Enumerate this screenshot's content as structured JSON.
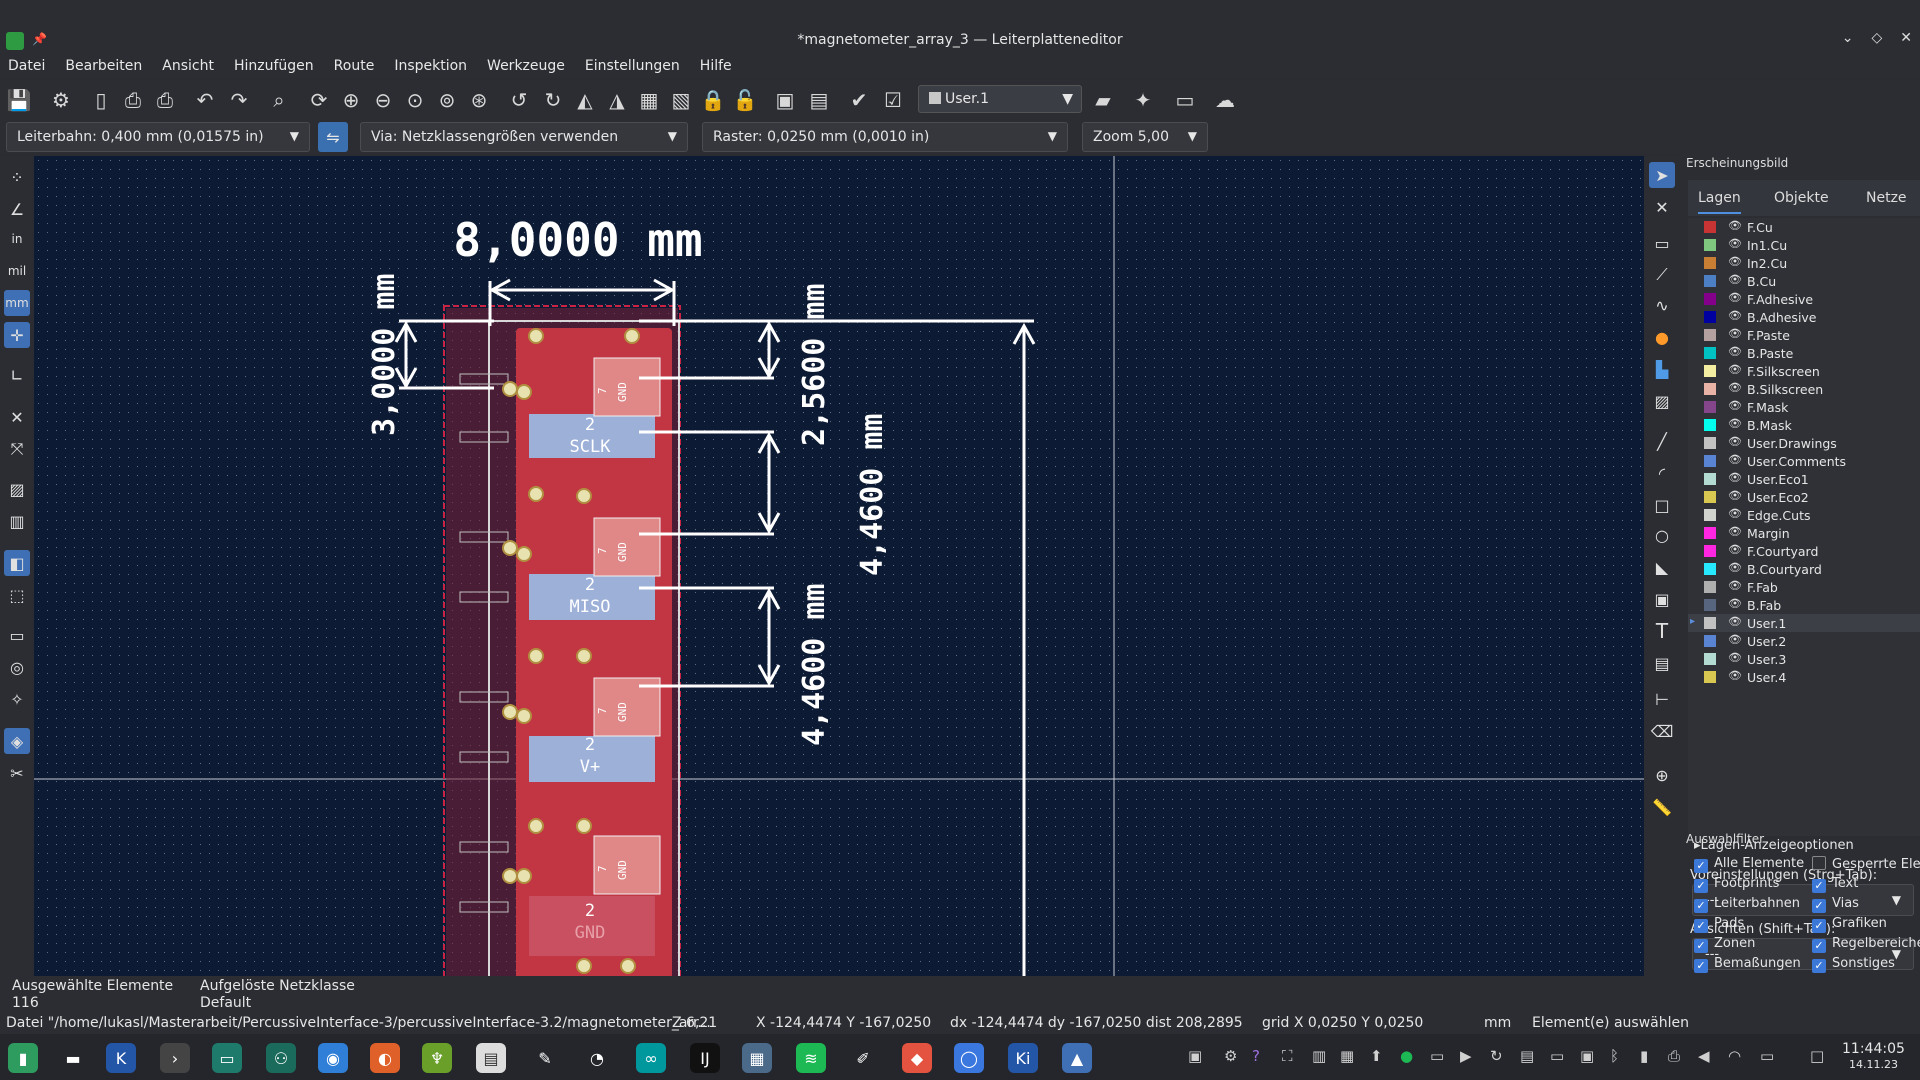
{
  "window": {
    "title": "*magnetometer_array_3 — Leiterplatteneditor"
  },
  "menu": [
    "Datei",
    "Bearbeiten",
    "Ansicht",
    "Hinzufügen",
    "Route",
    "Inspektion",
    "Werkzeuge",
    "Einstellungen",
    "Hilfe"
  ],
  "toolbar": {
    "layer_select": "User.1"
  },
  "toolbar2": {
    "track_width": "Leiterbahn: 0,400 mm (0,01575 in)",
    "via_size": "Via: Netzklassengrößen verwenden",
    "grid": "Raster: 0,0250 mm (0,0010 in)",
    "zoom": "Zoom 5,00"
  },
  "left_toolbar": {
    "units_in": "in",
    "units_mil": "mil",
    "units_mm": "mm"
  },
  "canvas": {
    "dim_width": "8,0000 mm",
    "dim_left": "3,0000 mm",
    "dim_a": "2,5600 mm",
    "dim_b": "4,4600 mm",
    "dim_c": "4,4600 mm",
    "pad_labels": [
      "SCLK",
      "MISO",
      "V+",
      "GND"
    ],
    "pad_numbers": [
      "2",
      "2",
      "2",
      "2"
    ],
    "gnd_text": "GND",
    "seven": "7"
  },
  "panel": {
    "title": "Erscheinungsbild",
    "tabs": [
      "Lagen",
      "Objekte",
      "Netze"
    ],
    "layers": [
      {
        "name": "F.Cu",
        "color": "#c83434"
      },
      {
        "name": "In1.Cu",
        "color": "#7fc87f"
      },
      {
        "name": "In2.Cu",
        "color": "#c87f34"
      },
      {
        "name": "B.Cu",
        "color": "#4d7fc4"
      },
      {
        "name": "F.Adhesive",
        "color": "#84008a"
      },
      {
        "name": "B.Adhesive",
        "color": "#0000a0"
      },
      {
        "name": "F.Paste",
        "color": "#b4a09e"
      },
      {
        "name": "B.Paste",
        "color": "#00c2c2"
      },
      {
        "name": "F.Silkscreen",
        "color": "#f2eda1"
      },
      {
        "name": "B.Silkscreen",
        "color": "#e8b2a7"
      },
      {
        "name": "F.Mask",
        "color": "#84458a"
      },
      {
        "name": "B.Mask",
        "color": "#02ffee"
      },
      {
        "name": "User.Drawings",
        "color": "#c2c2c2"
      },
      {
        "name": "User.Comments",
        "color": "#5984d4"
      },
      {
        "name": "User.Eco1",
        "color": "#b4dbd2"
      },
      {
        "name": "User.Eco2",
        "color": "#d8c852"
      },
      {
        "name": "Edge.Cuts",
        "color": "#d0d2cd"
      },
      {
        "name": "Margin",
        "color": "#ff26e2"
      },
      {
        "name": "F.Courtyard",
        "color": "#ff26e2"
      },
      {
        "name": "B.Courtyard",
        "color": "#26e9ff"
      },
      {
        "name": "F.Fab",
        "color": "#afafaf"
      },
      {
        "name": "B.Fab",
        "color": "#58657f"
      },
      {
        "name": "User.1",
        "color": "#c2c2c2"
      },
      {
        "name": "User.2",
        "color": "#5984d4"
      },
      {
        "name": "User.3",
        "color": "#b4dbd2"
      },
      {
        "name": "User.4",
        "color": "#d8c852"
      }
    ],
    "layer_options": "Lagen-Anzeigeoptionen",
    "presets_label": "Voreinstellungen (Strg+Tab):",
    "presets_value": "---",
    "views_label": "Ansichten (Shift+Tab):",
    "views_value": "---",
    "filter_title": "Auswahlfilter",
    "filters": [
      {
        "label": "Alle Elemente",
        "checked": true
      },
      {
        "label": "Gesperrte Elem",
        "checked": false
      },
      {
        "label": "Footprints",
        "checked": true
      },
      {
        "label": "Text",
        "checked": true
      },
      {
        "label": "Leiterbahnen",
        "checked": true
      },
      {
        "label": "Vias",
        "checked": true
      },
      {
        "label": "Pads",
        "checked": true
      },
      {
        "label": "Grafiken",
        "checked": true
      },
      {
        "label": "Zonen",
        "checked": true
      },
      {
        "label": "Regelbereiche",
        "checked": true
      },
      {
        "label": "Bemaßungen",
        "checked": true
      },
      {
        "label": "Sonstiges",
        "checked": true
      }
    ]
  },
  "status": {
    "selected_label": "Ausgewählte Elemente",
    "selected_value": "116",
    "netclass_label": "Aufgelöste Netzklasse",
    "netclass_value": "Default",
    "file": "Datei \"/home/lukasl/Masterarbeit/PercussiveInterface-3/percussiveInterface-3.2/magnetometer_arr...",
    "zoom": "Z 6,21",
    "xy": "X -124,4474  Y -167,0250",
    "delta": "dx -124,4474  dy -167,0250  dist 208,2895",
    "grid": "grid X 0,0250  Y 0,0250",
    "units": "mm",
    "mode": "Element(e) auswählen"
  },
  "taskbar": {
    "time": "11:44:05",
    "date": "14.11.23"
  }
}
